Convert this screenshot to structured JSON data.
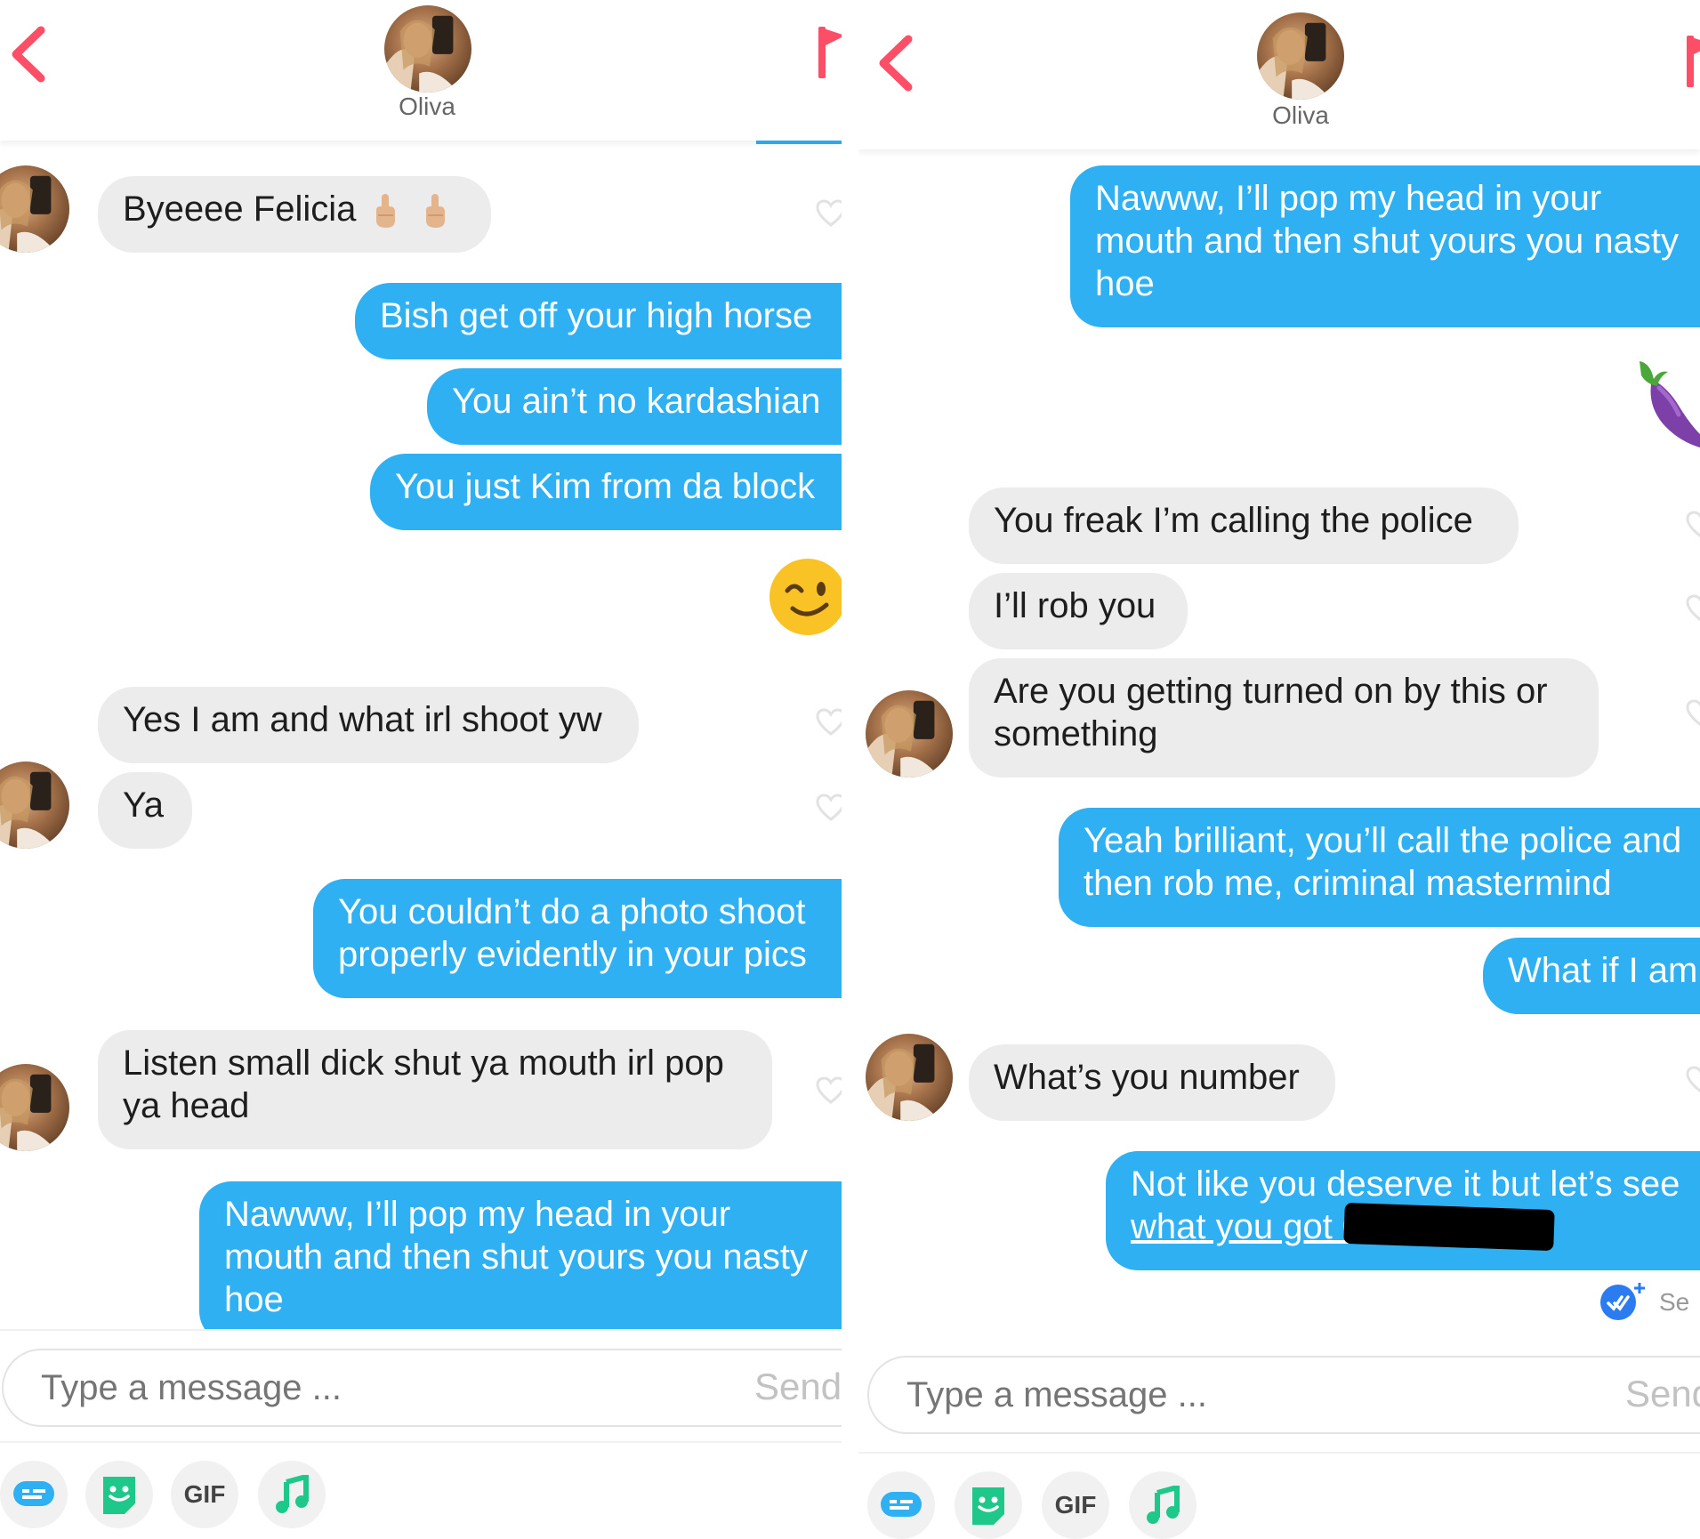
{
  "contact": {
    "name": "Oliva"
  },
  "composer": {
    "placeholder": "Type a message ...",
    "send_label": "Send",
    "gif_label": "GIF"
  },
  "colors": {
    "accent": "#fd4e68",
    "outgoing_bubble": "#2eb0f3",
    "incoming_bubble": "#ececec"
  },
  "icons": [
    "back-chevron-icon",
    "flag-icon",
    "heart-icon",
    "chat-bubble-icon",
    "sticker-icon",
    "gif-icon",
    "music-note-icon",
    "eggplant-emoji",
    "winking-emoji",
    "middle-finger-emoji",
    "read-receipt-icon"
  ],
  "left": {
    "messages": [
      {
        "text": "Byeeee Felicia",
        "from": "match"
      },
      {
        "text": "Bish get off your high horse",
        "from": "me"
      },
      {
        "text": "You ain’t no kardashian",
        "from": "me"
      },
      {
        "text": "You just Kim from da block",
        "from": "me"
      },
      {
        "text": "😉",
        "from": "me"
      },
      {
        "text": "Yes I am and what irl shoot yw",
        "from": "match"
      },
      {
        "text": "Ya",
        "from": "match"
      },
      {
        "lines": [
          "You couldn’t do a photo shoot",
          "properly evidently in your pics"
        ],
        "from": "me"
      },
      {
        "lines": [
          "Listen small dick shut ya mouth irl pop",
          "ya head"
        ],
        "from": "match"
      },
      {
        "lines": [
          "Nawww, I’ll pop my head in your",
          "mouth and then shut yours you nasty",
          "hoe"
        ],
        "from": "me"
      }
    ]
  },
  "right": {
    "messages": [
      {
        "lines": [
          "Nawww, I’ll pop my head in your",
          "mouth and then shut yours you nasty",
          "hoe"
        ],
        "from": "me"
      },
      {
        "text": "🍆",
        "from": "me"
      },
      {
        "text": "You freak I’m calling the police",
        "from": "match"
      },
      {
        "text": "I’ll rob you",
        "from": "match"
      },
      {
        "lines": [
          "Are you getting turned on by this or",
          "something"
        ],
        "from": "match"
      },
      {
        "lines": [
          "Yeah brilliant, you’ll call the police and",
          "then rob me, criminal mastermind"
        ],
        "from": "me"
      },
      {
        "text": "What if I am",
        "from": "me"
      },
      {
        "text": "What’s you number",
        "from": "match"
      },
      {
        "lines": [
          "Not like you deserve it but let’s see",
          "what you got 07"
        ],
        "from": "me"
      }
    ],
    "seen_label": "Se"
  }
}
